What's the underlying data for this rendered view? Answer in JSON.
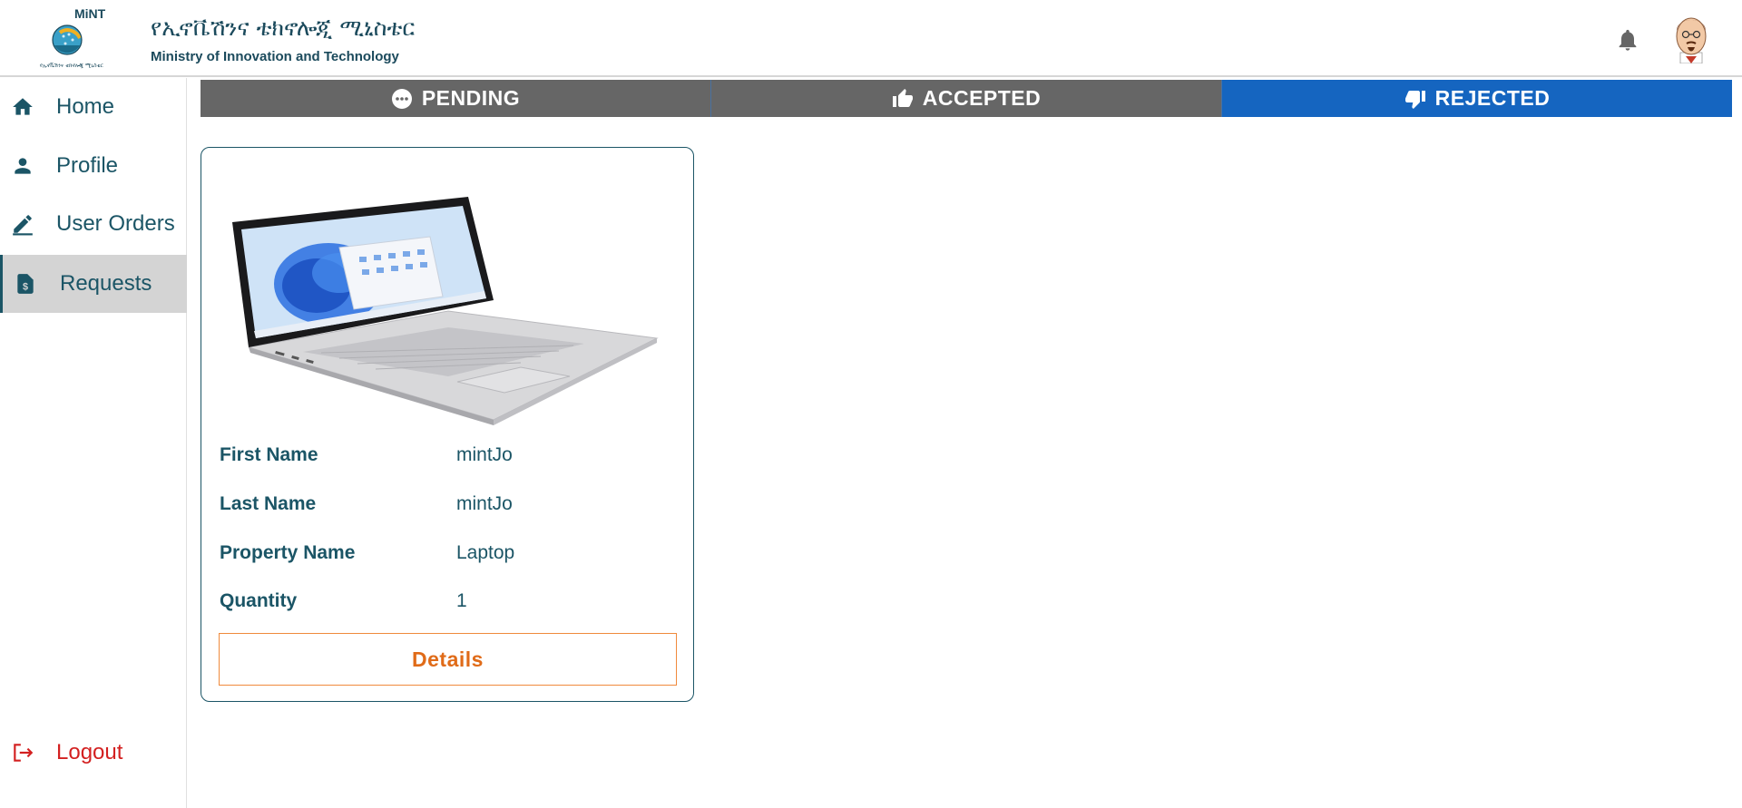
{
  "brand": {
    "logo_text": "MiNT",
    "logo_caption": "የኢኖቬሽንና ቴክኖሎጂ ሚኒስቴር",
    "title_amharic": "የኢኖቬሽንና ቴክኖሎጂ ሚኒስቴር",
    "title_english": "Ministry of Innovation and Technology"
  },
  "header": {
    "bell_icon": "bell-icon",
    "avatar_icon": "user-avatar"
  },
  "sidebar": {
    "items": [
      {
        "label": "Home",
        "icon": "home-icon"
      },
      {
        "label": "Profile",
        "icon": "person-icon"
      },
      {
        "label": "User Orders",
        "icon": "edit-icon"
      },
      {
        "label": "Requests",
        "icon": "document-dollar-icon",
        "active": true
      }
    ],
    "logout": {
      "label": "Logout",
      "icon": "logout-icon"
    }
  },
  "tabs": [
    {
      "label": "PENDING",
      "icon": "more-dots-icon"
    },
    {
      "label": "ACCEPTED",
      "icon": "thumbs-up-icon"
    },
    {
      "label": "REJECTED",
      "icon": "thumbs-down-icon",
      "active": true
    }
  ],
  "card": {
    "image": "laptop-image",
    "fields": [
      {
        "key": "First Name",
        "value": "mintJo"
      },
      {
        "key": "Last Name",
        "value": "mintJo"
      },
      {
        "key": "Property Name",
        "value": "Laptop"
      },
      {
        "key": "Quantity",
        "value": "1"
      }
    ],
    "button_label": "Details"
  },
  "colors": {
    "primary": "#1b5566",
    "tab_inactive": "#666666",
    "tab_active": "#1565c0",
    "accent_orange": "#f08a3c",
    "logout_red": "#d32020",
    "active_nav_bg": "#d4d4d4"
  }
}
